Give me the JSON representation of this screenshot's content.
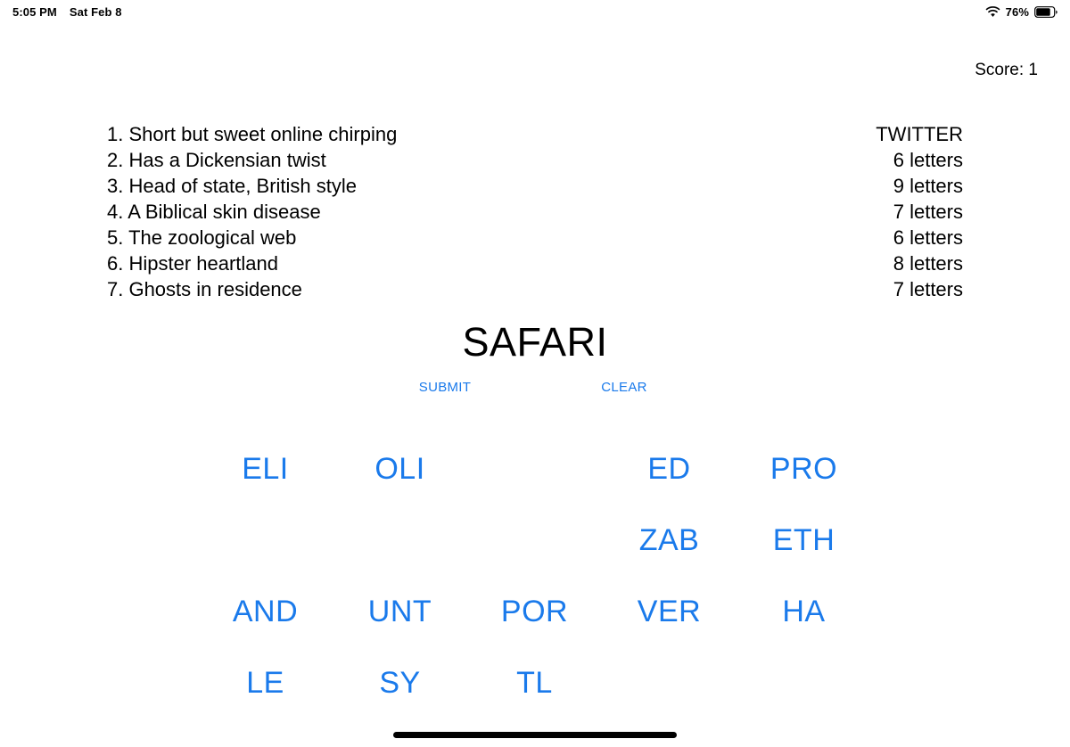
{
  "statusbar": {
    "time": "5:05 PM",
    "date": "Sat Feb 8",
    "wifi_icon": "wifi-icon",
    "battery_percent": "76%",
    "battery_icon": "battery-icon",
    "battery_level": 76
  },
  "game": {
    "score_label": "Score: 1",
    "current_word": "SAFARI",
    "submit_label": "SUBMIT",
    "clear_label": "CLEAR",
    "accent_color": "#1a7aeb",
    "text_color": "#000000"
  },
  "clues": [
    {
      "text": "1. Short but sweet online chirping",
      "answer": "TWITTER"
    },
    {
      "text": "2. Has a Dickensian twist",
      "answer": "6 letters"
    },
    {
      "text": "3. Head of state, British style",
      "answer": "9 letters"
    },
    {
      "text": "4. A Biblical skin disease",
      "answer": "7 letters"
    },
    {
      "text": "5. The zoological web",
      "answer": "6 letters"
    },
    {
      "text": "6. Hipster heartland",
      "answer": "8 letters"
    },
    {
      "text": "7. Ghosts in residence",
      "answer": "7 letters"
    }
  ],
  "tiles": [
    "ELI",
    "OLI",
    "",
    "ED",
    "PRO",
    "",
    "",
    "",
    "ZAB",
    "ETH",
    "AND",
    "UNT",
    "POR",
    "VER",
    "HA",
    "LE",
    "SY",
    "TL",
    "",
    ""
  ]
}
